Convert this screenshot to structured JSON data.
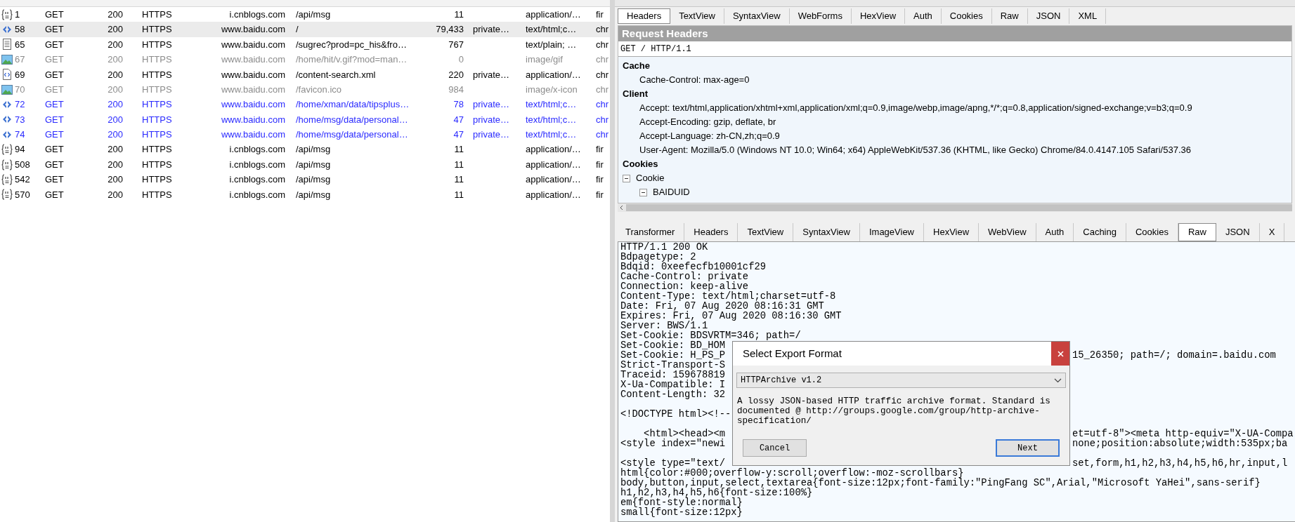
{
  "sessions": {
    "rows": [
      {
        "kind": "json",
        "dimmed": false,
        "highlighted": false,
        "selected": false,
        "column_1": "1",
        "column_2": "GET",
        "column_3": "200",
        "column_4": "HTTPS",
        "column_5": "i.cnblogs.com",
        "column_6": "/api/msg",
        "column_7": "11",
        "column_9": "application/…",
        "column_10": "fir"
      },
      {
        "kind": "html",
        "dimmed": false,
        "highlighted": false,
        "selected": true,
        "column_1": "58",
        "column_2": "GET",
        "column_3": "200",
        "column_4": "HTTPS",
        "column_5": "www.baidu.com",
        "column_6": "/",
        "column_7": "79,433",
        "column_8": "private…",
        "column_9": "text/html;c…",
        "column_10": "chr"
      },
      {
        "kind": "text",
        "dimmed": false,
        "highlighted": false,
        "selected": false,
        "column_1": "65",
        "column_2": "GET",
        "column_3": "200",
        "column_4": "HTTPS",
        "column_5": "www.baidu.com",
        "column_6": "/sugrec?prod=pc_his&fro…",
        "column_7": "767",
        "column_9": "text/plain; …",
        "column_10": "chr"
      },
      {
        "kind": "image",
        "dimmed": true,
        "highlighted": false,
        "selected": false,
        "column_1": "67",
        "column_2": "GET",
        "column_3": "200",
        "column_4": "HTTPS",
        "column_5": "www.baidu.com",
        "column_6": "/home/hit/v.gif?mod=man…",
        "column_7": "0",
        "column_9": "image/gif",
        "column_10": "chr"
      },
      {
        "kind": "xml",
        "dimmed": false,
        "highlighted": false,
        "selected": false,
        "column_1": "69",
        "column_2": "GET",
        "column_3": "200",
        "column_4": "HTTPS",
        "column_5": "www.baidu.com",
        "column_6": "/content-search.xml",
        "column_7": "220",
        "column_8": "private…",
        "column_9": "application/…",
        "column_10": "chr"
      },
      {
        "kind": "image",
        "dimmed": true,
        "highlighted": false,
        "selected": false,
        "column_1": "70",
        "column_2": "GET",
        "column_3": "200",
        "column_4": "HTTPS",
        "column_5": "www.baidu.com",
        "column_6": "/favicon.ico",
        "column_7": "984",
        "column_9": "image/x-icon",
        "column_10": "chr"
      },
      {
        "kind": "html",
        "dimmed": false,
        "highlighted": true,
        "selected": false,
        "column_1": "72",
        "column_2": "GET",
        "column_3": "200",
        "column_4": "HTTPS",
        "column_5": "www.baidu.com",
        "column_6": "/home/xman/data/tipsplus…",
        "column_7": "78",
        "column_8": "private…",
        "column_9": "text/html;c…",
        "column_10": "chr"
      },
      {
        "kind": "html",
        "dimmed": false,
        "highlighted": true,
        "selected": false,
        "column_1": "73",
        "column_2": "GET",
        "column_3": "200",
        "column_4": "HTTPS",
        "column_5": "www.baidu.com",
        "column_6": "/home/msg/data/personal…",
        "column_7": "47",
        "column_8": "private…",
        "column_9": "text/html;c…",
        "column_10": "chr"
      },
      {
        "kind": "html",
        "dimmed": false,
        "highlighted": true,
        "selected": false,
        "column_1": "74",
        "column_2": "GET",
        "column_3": "200",
        "column_4": "HTTPS",
        "column_5": "www.baidu.com",
        "column_6": "/home/msg/data/personal…",
        "column_7": "47",
        "column_8": "private…",
        "column_9": "text/html;c…",
        "column_10": "chr"
      },
      {
        "kind": "json",
        "dimmed": false,
        "highlighted": false,
        "selected": false,
        "column_1": "94",
        "column_2": "GET",
        "column_3": "200",
        "column_4": "HTTPS",
        "column_5": "i.cnblogs.com",
        "column_6": "/api/msg",
        "column_7": "11",
        "column_9": "application/…",
        "column_10": "fir"
      },
      {
        "kind": "json",
        "dimmed": false,
        "highlighted": false,
        "selected": false,
        "column_1": "508",
        "column_2": "GET",
        "column_3": "200",
        "column_4": "HTTPS",
        "column_5": "i.cnblogs.com",
        "column_6": "/api/msg",
        "column_7": "11",
        "column_9": "application/…",
        "column_10": "fir"
      },
      {
        "kind": "json",
        "dimmed": false,
        "highlighted": false,
        "selected": false,
        "column_1": "542",
        "column_2": "GET",
        "column_3": "200",
        "column_4": "HTTPS",
        "column_5": "i.cnblogs.com",
        "column_6": "/api/msg",
        "column_7": "11",
        "column_9": "application/…",
        "column_10": "fir"
      },
      {
        "kind": "json",
        "dimmed": false,
        "highlighted": false,
        "selected": false,
        "column_1": "570",
        "column_2": "GET",
        "column_3": "200",
        "column_4": "HTTPS",
        "column_5": "i.cnblogs.com",
        "column_6": "/api/msg",
        "column_7": "11",
        "column_9": "application/…",
        "column_10": "fir"
      }
    ]
  },
  "request_tabs": [
    {
      "label": "Headers",
      "selected": true
    },
    {
      "label": "TextView",
      "selected": false
    },
    {
      "label": "SyntaxView",
      "selected": false
    },
    {
      "label": "WebForms",
      "selected": false
    },
    {
      "label": "HexView",
      "selected": false
    },
    {
      "label": "Auth",
      "selected": false
    },
    {
      "label": "Cookies",
      "selected": false
    },
    {
      "label": "Raw",
      "selected": false
    },
    {
      "label": "JSON",
      "selected": false
    },
    {
      "label": "XML",
      "selected": false
    }
  ],
  "request_headers": {
    "title": "Request Headers",
    "request_line": "GET / HTTP/1.1",
    "groups": [
      {
        "name": "Cache",
        "items": [
          {
            "text": "Cache-Control: max-age=0"
          }
        ]
      },
      {
        "name": "Client",
        "items": [
          {
            "text": "Accept: text/html,application/xhtml+xml,application/xml;q=0.9,image/webp,image/apng,*/*;q=0.8,application/signed-exchange;v=b3;q=0.9"
          },
          {
            "text": "Accept-Encoding: gzip, deflate, br"
          },
          {
            "text": "Accept-Language: zh-CN,zh;q=0.9"
          },
          {
            "text": "User-Agent: Mozilla/5.0 (Windows NT 10.0; Win64; x64) AppleWebKit/537.36 (KHTML, like Gecko) Chrome/84.0.4147.105 Safari/537.36"
          }
        ]
      },
      {
        "name": "Cookies",
        "items": [
          {
            "text": "Cookie",
            "expanded": true,
            "children": [
              {
                "text": "BAIDUID",
                "expanded": true
              }
            ]
          }
        ]
      }
    ]
  },
  "response_tabs": [
    {
      "label": "Transformer",
      "selected": false
    },
    {
      "label": "Headers",
      "selected": false
    },
    {
      "label": "TextView",
      "selected": false
    },
    {
      "label": "SyntaxView",
      "selected": false
    },
    {
      "label": "ImageView",
      "selected": false
    },
    {
      "label": "HexView",
      "selected": false
    },
    {
      "label": "WebView",
      "selected": false
    },
    {
      "label": "Auth",
      "selected": false
    },
    {
      "label": "Caching",
      "selected": false
    },
    {
      "label": "Cookies",
      "selected": false
    },
    {
      "label": "Raw",
      "selected": true
    },
    {
      "label": "JSON",
      "selected": false
    },
    {
      "label": "X",
      "selected": false
    }
  ],
  "raw_lines": [
    {
      "kind": "line",
      "text": "HTTP/1.1 200 OK"
    },
    {
      "kind": "line",
      "text": "Bdpagetype: 2"
    },
    {
      "kind": "line",
      "text": "Bdqid: 0xeefecfb10001cf29"
    },
    {
      "kind": "line",
      "text": "Cache-Control: private"
    },
    {
      "kind": "line",
      "text": "Connection: keep-alive"
    },
    {
      "kind": "line",
      "text": "Content-Type: text/html;charset=utf-8"
    },
    {
      "kind": "line",
      "text": "Date: Fri, 07 Aug 2020 08:16:31 GMT"
    },
    {
      "kind": "line",
      "text": "Expires: Fri, 07 Aug 2020 08:16:30 GMT"
    },
    {
      "kind": "line",
      "text": "Server: BWS/1.1"
    },
    {
      "kind": "line",
      "text": "Set-Cookie: BDSVRTM=346; path=/"
    },
    {
      "kind": "line",
      "text": "Set-Cookie: BD_HOM"
    },
    {
      "kind": "line",
      "text": "Set-Cookie: H_PS_P",
      "tail": "15_26350; path=/; domain=.baidu.com"
    },
    {
      "kind": "line",
      "text": "Strict-Transport-S"
    },
    {
      "kind": "line",
      "text": "Traceid: 159678819"
    },
    {
      "kind": "line",
      "text": "X-Ua-Compatible: I"
    },
    {
      "kind": "line",
      "text": "Content-Length: 32"
    },
    {
      "kind": "blank"
    },
    {
      "kind": "line",
      "text": "<!DOCTYPE html><!--"
    },
    {
      "kind": "blank"
    },
    {
      "kind": "line",
      "text": "    <html><head><m",
      "tail": "et=utf-8\"><meta http-equiv=\"X-UA-Compa"
    },
    {
      "kind": "line",
      "text": "<style index=\"newi",
      "tail": "none;position:absolute;width:535px;ba"
    },
    {
      "kind": "blank"
    },
    {
      "kind": "line",
      "text": "<style type=\"text/",
      "tail": "set,form,h1,h2,h3,h4,h5,h6,hr,input,l"
    },
    {
      "kind": "line",
      "text": "html{color:#000;overflow-y:scroll;overflow:-moz-scrollbars}"
    },
    {
      "kind": "line",
      "text": "body,button,input,select,textarea{font-size:12px;font-family:\"PingFang SC\",Arial,\"Microsoft YaHei\",sans-serif}"
    },
    {
      "kind": "line",
      "text": "h1,h2,h3,h4,h5,h6{font-size:100%}"
    },
    {
      "kind": "line",
      "text": "em{font-style:normal}"
    },
    {
      "kind": "line",
      "text": "small{font-size:12px}"
    }
  ],
  "dialog": {
    "title": "Select Export Format",
    "format": "HTTPArchive v1.2",
    "description": "A lossy JSON-based HTTP traffic archive format. Standard is documented @ http://groups.google.com/group/http-archive-specification/",
    "buttons": [
      {
        "label": "Cancel",
        "default": false
      },
      {
        "label": "Next",
        "default": true
      }
    ]
  }
}
